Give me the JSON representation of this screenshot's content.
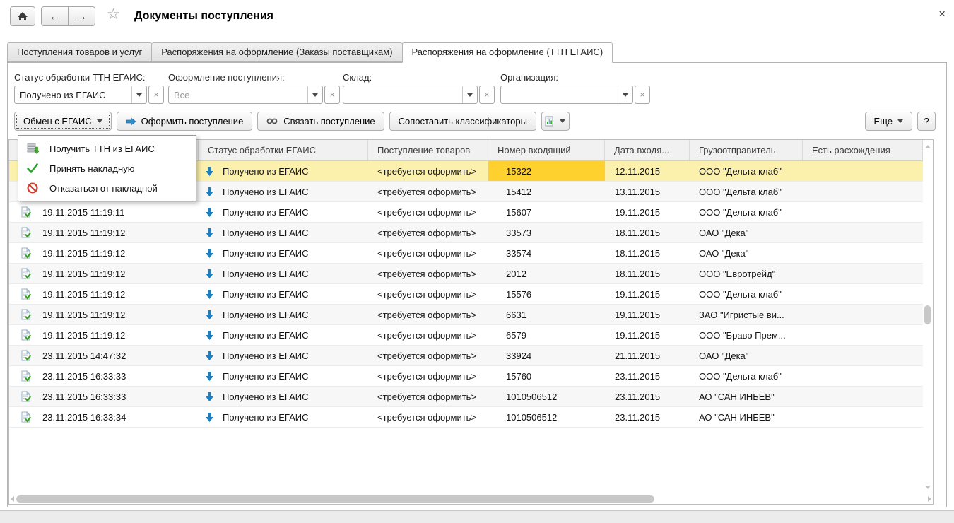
{
  "titlebar": {
    "title": "Документы поступления",
    "back": "←",
    "forward": "→",
    "star": "☆",
    "close": "×"
  },
  "tabs": [
    {
      "label": "Поступления товаров и услуг",
      "active": false
    },
    {
      "label": "Распоряжения на оформление (Заказы поставщикам)",
      "active": false
    },
    {
      "label": "Распоряжения на оформление (ТТН ЕГАИС)",
      "active": true
    }
  ],
  "filters": {
    "status": {
      "label": "Статус обработки ТТН ЕГАИС:",
      "value": "Получено из ЕГАИС",
      "placeholder": ""
    },
    "registration": {
      "label": "Оформление поступления:",
      "value": "",
      "placeholder": "Все"
    },
    "warehouse": {
      "label": "Склад:",
      "value": "",
      "placeholder": ""
    },
    "organization": {
      "label": "Организация:",
      "value": "",
      "placeholder": ""
    }
  },
  "toolbar": {
    "exchange": "Обмен с ЕГАИС",
    "register": "Оформить поступление",
    "link": "Связать поступление",
    "match": "Сопоставить классификаторы",
    "more": "Еще",
    "help": "?"
  },
  "menu": [
    {
      "icon": "download-ttn-icon",
      "label": "Получить ТТН из ЕГАИС"
    },
    {
      "icon": "accept-invoice-icon",
      "label": "Принять накладную"
    },
    {
      "icon": "reject-invoice-icon",
      "label": "Отказаться от накладной"
    }
  ],
  "table": {
    "columns": {
      "received": "",
      "status": "Статус обработки ЕГАИС",
      "receipt": "Поступление товаров",
      "number": "Номер входящий",
      "date_in": "Дата входя...",
      "shipper": "Грузоотправитель",
      "discrepancy": "Есть расхождения"
    },
    "rows": [
      {
        "received": "",
        "status": "Получено из ЕГАИС",
        "receipt": "<требуется оформить>",
        "number": "15322",
        "date_in": "12.11.2015",
        "shipper": "ООО \"Дельта клаб\"",
        "discrepancy": "",
        "selected": true,
        "active_cell": "number",
        "doc_icon": false
      },
      {
        "received": "",
        "status": "Получено из ЕГАИС",
        "receipt": "<требуется оформить>",
        "number": "15412",
        "date_in": "13.11.2015",
        "shipper": "ООО \"Дельта клаб\"",
        "discrepancy": "",
        "doc_icon": false
      },
      {
        "received": "19.11.2015 11:19:11",
        "status": "Получено из ЕГАИС",
        "receipt": "<требуется оформить>",
        "number": "15607",
        "date_in": "19.11.2015",
        "shipper": "ООО \"Дельта клаб\"",
        "discrepancy": ""
      },
      {
        "received": "19.11.2015 11:19:12",
        "status": "Получено из ЕГАИС",
        "receipt": "<требуется оформить>",
        "number": "33573",
        "date_in": "18.11.2015",
        "shipper": "ОАО \"Дека\"",
        "discrepancy": ""
      },
      {
        "received": "19.11.2015 11:19:12",
        "status": "Получено из ЕГАИС",
        "receipt": "<требуется оформить>",
        "number": "33574",
        "date_in": "18.11.2015",
        "shipper": "ОАО \"Дека\"",
        "discrepancy": ""
      },
      {
        "received": "19.11.2015 11:19:12",
        "status": "Получено из ЕГАИС",
        "receipt": "<требуется оформить>",
        "number": "2012",
        "date_in": "18.11.2015",
        "shipper": "ООО \"Евротрейд\"",
        "discrepancy": ""
      },
      {
        "received": "19.11.2015 11:19:12",
        "status": "Получено из ЕГАИС",
        "receipt": "<требуется оформить>",
        "number": "15576",
        "date_in": "19.11.2015",
        "shipper": "ООО \"Дельта клаб\"",
        "discrepancy": ""
      },
      {
        "received": "19.11.2015 11:19:12",
        "status": "Получено из ЕГАИС",
        "receipt": "<требуется оформить>",
        "number": "6631",
        "date_in": "19.11.2015",
        "shipper": "ЗАО \"Игристые ви...",
        "discrepancy": ""
      },
      {
        "received": "19.11.2015 11:19:12",
        "status": "Получено из ЕГАИС",
        "receipt": "<требуется оформить>",
        "number": "6579",
        "date_in": "19.11.2015",
        "shipper": "ООО \"Браво Прем...",
        "discrepancy": ""
      },
      {
        "received": "23.11.2015 14:47:32",
        "status": "Получено из ЕГАИС",
        "receipt": "<требуется оформить>",
        "number": "33924",
        "date_in": "21.11.2015",
        "shipper": "ОАО \"Дека\"",
        "discrepancy": ""
      },
      {
        "received": "23.11.2015 16:33:33",
        "status": "Получено из ЕГАИС",
        "receipt": "<требуется оформить>",
        "number": "15760",
        "date_in": "23.11.2015",
        "shipper": "ООО \"Дельта клаб\"",
        "discrepancy": ""
      },
      {
        "received": "23.11.2015 16:33:33",
        "status": "Получено из ЕГАИС",
        "receipt": "<требуется оформить>",
        "number": "1010506512",
        "date_in": "23.11.2015",
        "shipper": "АО \"САН ИНБЕВ\"",
        "discrepancy": ""
      },
      {
        "received": "23.11.2015 16:33:34",
        "status": "Получено из ЕГАИС",
        "receipt": "<требуется оформить>",
        "number": "1010506512",
        "date_in": "23.11.2015",
        "shipper": "АО \"САН ИНБЕВ\"",
        "discrepancy": ""
      }
    ]
  },
  "colors": {
    "selected_row": "#fcf0ad",
    "active_cell": "#fed12e",
    "incoming_arrow_blue": "#1b7fc4",
    "accept_green": "#2ca32c",
    "reject_red": "#d23b2f"
  }
}
